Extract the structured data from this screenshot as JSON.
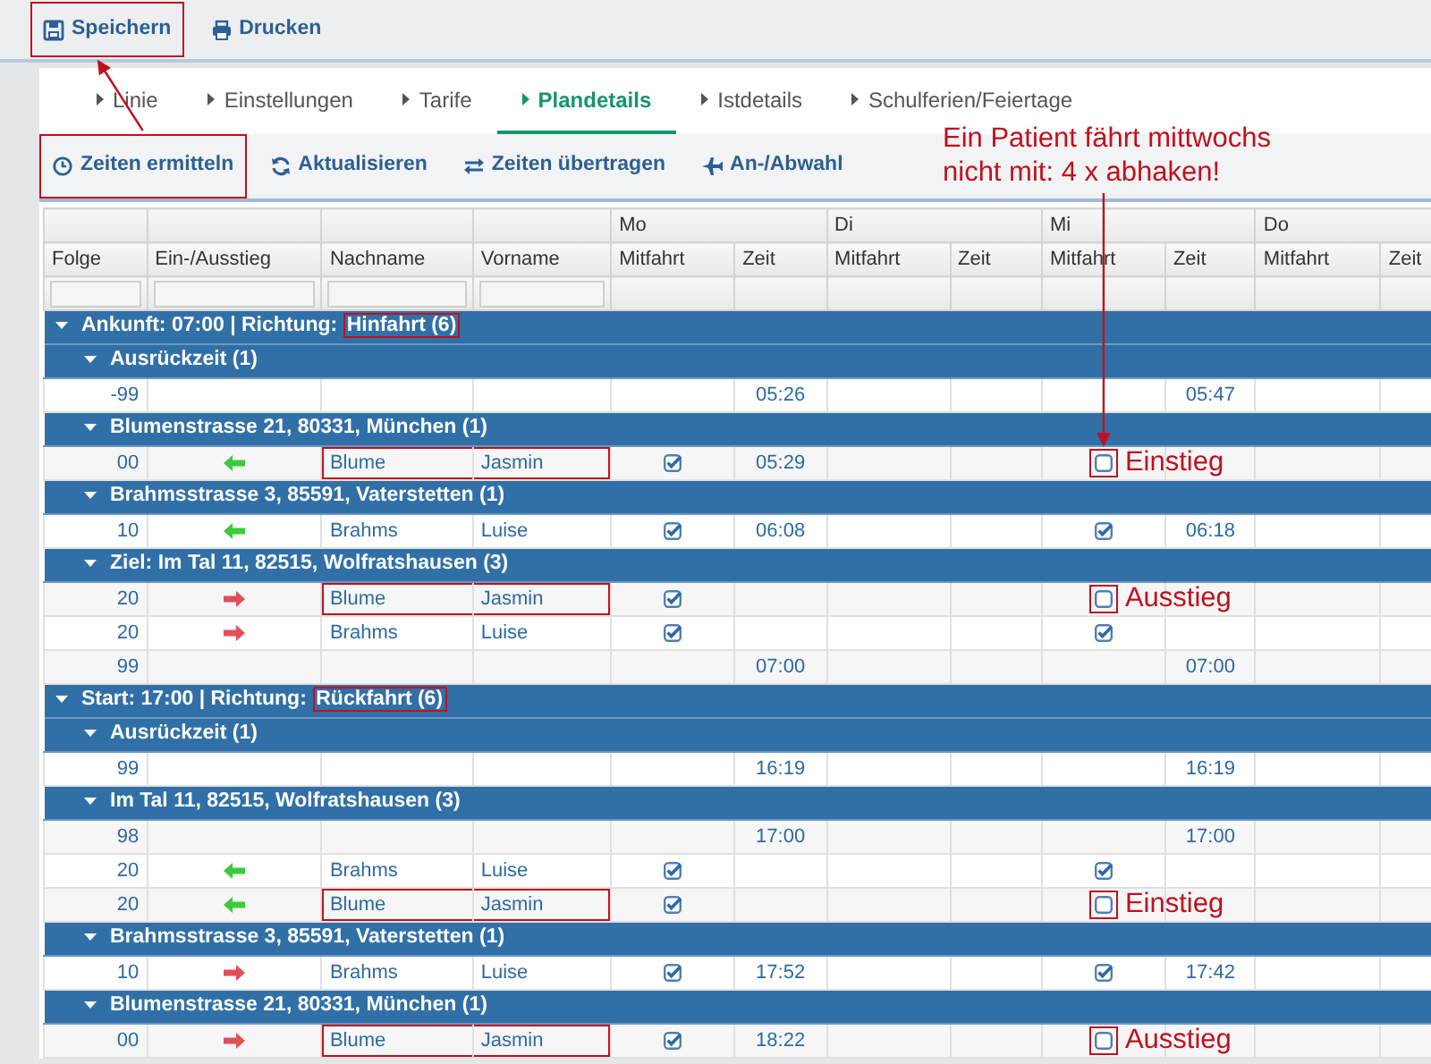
{
  "toolbar": {
    "buttons": [
      {
        "label": "Speichern",
        "kind": "save",
        "highlighted": true
      },
      {
        "label": "Drucken",
        "kind": "print",
        "highlighted": false
      }
    ]
  },
  "tabs": [
    {
      "label": "Linie",
      "selected": false
    },
    {
      "label": "Einstellungen",
      "selected": false
    },
    {
      "label": "Tarife",
      "selected": false
    },
    {
      "label": "Plandetails",
      "selected": true
    },
    {
      "label": "Istdetails",
      "selected": false
    },
    {
      "label": "Schulferien/Feiertage",
      "selected": false
    }
  ],
  "actions": [
    {
      "label": "Zeiten ermitteln",
      "kind": "clock",
      "highlighted": true
    },
    {
      "label": "Aktualisieren",
      "kind": "refresh",
      "highlighted": false
    },
    {
      "label": "Zeiten übertragen",
      "kind": "swap",
      "highlighted": false
    },
    {
      "label": "An-/Abwahl",
      "kind": "plane",
      "highlighted": false
    }
  ],
  "callout": {
    "lines": [
      "Ein Patient fährt mittwochs",
      "nicht mit: 4 x abhaken!"
    ]
  },
  "table": {
    "columns": [
      "Folge",
      "Ein-/Ausstieg",
      "Nachname",
      "Vorname"
    ],
    "days": [
      {
        "label": "Mo",
        "columns": [
          "Mitfahrt",
          "Zeit"
        ]
      },
      {
        "label": "Di",
        "columns": [
          "Mitfahrt",
          "Zeit"
        ]
      },
      {
        "label": "Mi",
        "columns": [
          "Mitfahrt",
          "Zeit"
        ]
      },
      {
        "label": "Do",
        "columns": [
          "Mitfahrt",
          "Zeit"
        ]
      }
    ],
    "groups": [
      {
        "label": "Ankunft: 07:00 | Richtung:",
        "direction": "Hinfahrt",
        "count": "(6)",
        "highlighted": true,
        "expanded": true,
        "children": [
          {
            "label": "Ausrückzeit",
            "count": "(1)",
            "expanded": true,
            "rows": [
              {
                "kind": "time",
                "folge": "-99",
                "mo": {
                  "zeit": "05:26"
                },
                "mi": {
                  "zeit": "05:47"
                }
              }
            ]
          },
          {
            "label": "Blumenstrasse 21, 80331, München",
            "count": "(1)",
            "expanded": true,
            "rows": [
              {
                "kind": "einstieg",
                "folge": "00",
                "nachname": "Blume",
                "vorname": "Jasmin",
                "highlighted": true,
                "mo": {
                  "mitfahrt": true,
                  "zeit": "05:29"
                },
                "mi": {
                  "mitfahrt": false,
                  "highlighted": true,
                  "note": "Einstieg"
                }
              }
            ]
          },
          {
            "label": "Brahmsstrasse 3, 85591, Vaterstetten",
            "count": "(1)",
            "expanded": true,
            "rows": [
              {
                "kind": "einstieg",
                "folge": "10",
                "nachname": "Brahms",
                "vorname": "Luise",
                "highlighted": false,
                "mo": {
                  "mitfahrt": true,
                  "zeit": "06:08"
                },
                "mi": {
                  "mitfahrt": true,
                  "highlighted": false,
                  "zeit": "06:18"
                }
              }
            ]
          },
          {
            "label": "Ziel: Im Tal 11, 82515, Wolfratshausen",
            "count": "(3)",
            "expanded": true,
            "rows": [
              {
                "kind": "ausstieg",
                "folge": "20",
                "nachname": "Blume",
                "vorname": "Jasmin",
                "highlighted": true,
                "mo": {
                  "mitfahrt": true
                },
                "mi": {
                  "mitfahrt": false,
                  "highlighted": true,
                  "note": "Ausstieg"
                }
              },
              {
                "kind": "ausstieg",
                "folge": "20",
                "nachname": "Brahms",
                "vorname": "Luise",
                "highlighted": false,
                "mo": {
                  "mitfahrt": true
                },
                "mi": {
                  "mitfahrt": true,
                  "highlighted": false
                }
              },
              {
                "kind": "time",
                "folge": "99",
                "mo": {
                  "zeit": "07:00"
                },
                "mi": {
                  "zeit": "07:00"
                }
              }
            ]
          }
        ]
      },
      {
        "label": "Start: 17:00 | Richtung:",
        "direction": "Rückfahrt",
        "count": "(6)",
        "highlighted": true,
        "expanded": true,
        "children": [
          {
            "label": "Ausrückzeit",
            "count": "(1)",
            "expanded": true,
            "rows": [
              {
                "kind": "time",
                "folge": "99",
                "mo": {
                  "zeit": "16:19"
                },
                "mi": {
                  "zeit": "16:19"
                }
              }
            ]
          },
          {
            "label": "Im Tal 11, 82515, Wolfratshausen",
            "count": "(3)",
            "expanded": true,
            "rows": [
              {
                "kind": "time",
                "folge": "98",
                "mo": {
                  "zeit": "17:00"
                },
                "mi": {
                  "zeit": "17:00"
                }
              },
              {
                "kind": "einstieg",
                "folge": "20",
                "nachname": "Brahms",
                "vorname": "Luise",
                "highlighted": false,
                "mo": {
                  "mitfahrt": true
                },
                "mi": {
                  "mitfahrt": true,
                  "highlighted": false
                }
              },
              {
                "kind": "einstieg",
                "folge": "20",
                "nachname": "Blume",
                "vorname": "Jasmin",
                "highlighted": true,
                "mo": {
                  "mitfahrt": true
                },
                "mi": {
                  "mitfahrt": false,
                  "highlighted": true,
                  "note": "Einstieg"
                }
              }
            ]
          },
          {
            "label": "Brahmsstrasse 3, 85591, Vaterstetten",
            "count": "(1)",
            "expanded": true,
            "rows": [
              {
                "kind": "ausstieg",
                "folge": "10",
                "nachname": "Brahms",
                "vorname": "Luise",
                "highlighted": false,
                "mo": {
                  "mitfahrt": true,
                  "zeit": "17:52"
                },
                "mi": {
                  "mitfahrt": true,
                  "highlighted": false,
                  "zeit": "17:42"
                }
              }
            ]
          },
          {
            "label": "Blumenstrasse 21, 80331, München",
            "count": "(1)",
            "expanded": true,
            "rows": [
              {
                "kind": "ausstieg",
                "folge": "00",
                "nachname": "Blume",
                "vorname": "Jasmin",
                "highlighted": true,
                "mo": {
                  "mitfahrt": true,
                  "zeit": "18:22"
                },
                "mi": {
                  "mitfahrt": false,
                  "highlighted": true,
                  "note": "Ausstieg"
                }
              }
            ]
          }
        ]
      }
    ]
  }
}
